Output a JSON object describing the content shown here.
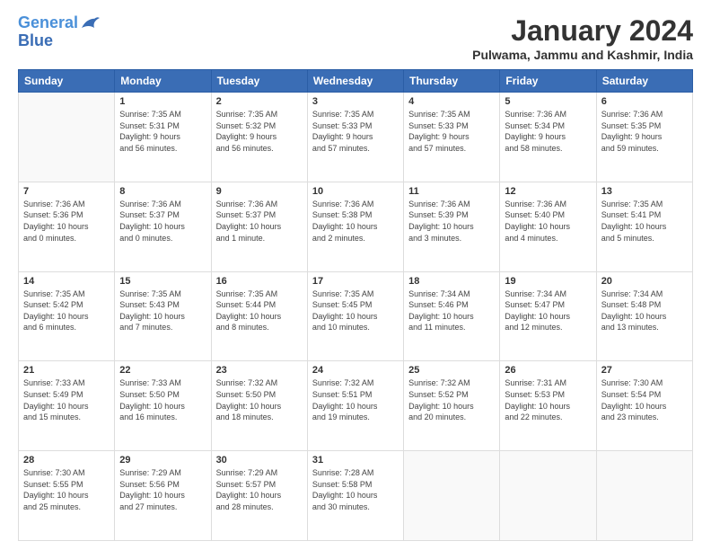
{
  "logo": {
    "line1": "General",
    "line2": "Blue"
  },
  "title": "January 2024",
  "subtitle": "Pulwama, Jammu and Kashmir, India",
  "days_header": [
    "Sunday",
    "Monday",
    "Tuesday",
    "Wednesday",
    "Thursday",
    "Friday",
    "Saturday"
  ],
  "weeks": [
    [
      {
        "day": "",
        "info": ""
      },
      {
        "day": "1",
        "info": "Sunrise: 7:35 AM\nSunset: 5:31 PM\nDaylight: 9 hours\nand 56 minutes."
      },
      {
        "day": "2",
        "info": "Sunrise: 7:35 AM\nSunset: 5:32 PM\nDaylight: 9 hours\nand 56 minutes."
      },
      {
        "day": "3",
        "info": "Sunrise: 7:35 AM\nSunset: 5:33 PM\nDaylight: 9 hours\nand 57 minutes."
      },
      {
        "day": "4",
        "info": "Sunrise: 7:35 AM\nSunset: 5:33 PM\nDaylight: 9 hours\nand 57 minutes."
      },
      {
        "day": "5",
        "info": "Sunrise: 7:36 AM\nSunset: 5:34 PM\nDaylight: 9 hours\nand 58 minutes."
      },
      {
        "day": "6",
        "info": "Sunrise: 7:36 AM\nSunset: 5:35 PM\nDaylight: 9 hours\nand 59 minutes."
      }
    ],
    [
      {
        "day": "7",
        "info": "Sunrise: 7:36 AM\nSunset: 5:36 PM\nDaylight: 10 hours\nand 0 minutes."
      },
      {
        "day": "8",
        "info": "Sunrise: 7:36 AM\nSunset: 5:37 PM\nDaylight: 10 hours\nand 0 minutes."
      },
      {
        "day": "9",
        "info": "Sunrise: 7:36 AM\nSunset: 5:37 PM\nDaylight: 10 hours\nand 1 minute."
      },
      {
        "day": "10",
        "info": "Sunrise: 7:36 AM\nSunset: 5:38 PM\nDaylight: 10 hours\nand 2 minutes."
      },
      {
        "day": "11",
        "info": "Sunrise: 7:36 AM\nSunset: 5:39 PM\nDaylight: 10 hours\nand 3 minutes."
      },
      {
        "day": "12",
        "info": "Sunrise: 7:36 AM\nSunset: 5:40 PM\nDaylight: 10 hours\nand 4 minutes."
      },
      {
        "day": "13",
        "info": "Sunrise: 7:35 AM\nSunset: 5:41 PM\nDaylight: 10 hours\nand 5 minutes."
      }
    ],
    [
      {
        "day": "14",
        "info": "Sunrise: 7:35 AM\nSunset: 5:42 PM\nDaylight: 10 hours\nand 6 minutes."
      },
      {
        "day": "15",
        "info": "Sunrise: 7:35 AM\nSunset: 5:43 PM\nDaylight: 10 hours\nand 7 minutes."
      },
      {
        "day": "16",
        "info": "Sunrise: 7:35 AM\nSunset: 5:44 PM\nDaylight: 10 hours\nand 8 minutes."
      },
      {
        "day": "17",
        "info": "Sunrise: 7:35 AM\nSunset: 5:45 PM\nDaylight: 10 hours\nand 10 minutes."
      },
      {
        "day": "18",
        "info": "Sunrise: 7:34 AM\nSunset: 5:46 PM\nDaylight: 10 hours\nand 11 minutes."
      },
      {
        "day": "19",
        "info": "Sunrise: 7:34 AM\nSunset: 5:47 PM\nDaylight: 10 hours\nand 12 minutes."
      },
      {
        "day": "20",
        "info": "Sunrise: 7:34 AM\nSunset: 5:48 PM\nDaylight: 10 hours\nand 13 minutes."
      }
    ],
    [
      {
        "day": "21",
        "info": "Sunrise: 7:33 AM\nSunset: 5:49 PM\nDaylight: 10 hours\nand 15 minutes."
      },
      {
        "day": "22",
        "info": "Sunrise: 7:33 AM\nSunset: 5:50 PM\nDaylight: 10 hours\nand 16 minutes."
      },
      {
        "day": "23",
        "info": "Sunrise: 7:32 AM\nSunset: 5:50 PM\nDaylight: 10 hours\nand 18 minutes."
      },
      {
        "day": "24",
        "info": "Sunrise: 7:32 AM\nSunset: 5:51 PM\nDaylight: 10 hours\nand 19 minutes."
      },
      {
        "day": "25",
        "info": "Sunrise: 7:32 AM\nSunset: 5:52 PM\nDaylight: 10 hours\nand 20 minutes."
      },
      {
        "day": "26",
        "info": "Sunrise: 7:31 AM\nSunset: 5:53 PM\nDaylight: 10 hours\nand 22 minutes."
      },
      {
        "day": "27",
        "info": "Sunrise: 7:30 AM\nSunset: 5:54 PM\nDaylight: 10 hours\nand 23 minutes."
      }
    ],
    [
      {
        "day": "28",
        "info": "Sunrise: 7:30 AM\nSunset: 5:55 PM\nDaylight: 10 hours\nand 25 minutes."
      },
      {
        "day": "29",
        "info": "Sunrise: 7:29 AM\nSunset: 5:56 PM\nDaylight: 10 hours\nand 27 minutes."
      },
      {
        "day": "30",
        "info": "Sunrise: 7:29 AM\nSunset: 5:57 PM\nDaylight: 10 hours\nand 28 minutes."
      },
      {
        "day": "31",
        "info": "Sunrise: 7:28 AM\nSunset: 5:58 PM\nDaylight: 10 hours\nand 30 minutes."
      },
      {
        "day": "",
        "info": ""
      },
      {
        "day": "",
        "info": ""
      },
      {
        "day": "",
        "info": ""
      }
    ]
  ]
}
